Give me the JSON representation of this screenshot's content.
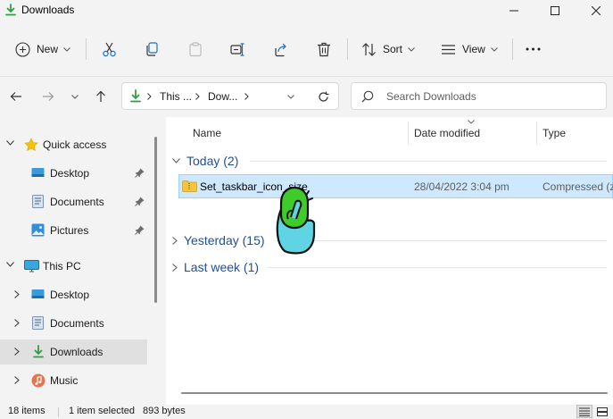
{
  "window": {
    "title": "Downloads"
  },
  "commands": {
    "new_label": "New",
    "sort_label": "Sort",
    "view_label": "View"
  },
  "address": {
    "crumbs": [
      "This ...",
      "Dow..."
    ]
  },
  "search": {
    "placeholder": "Search Downloads"
  },
  "nav": {
    "quick_access": "Quick access",
    "qa_items": [
      "Desktop",
      "Documents",
      "Pictures"
    ],
    "this_pc": "This PC",
    "pc_items": [
      "Desktop",
      "Documents",
      "Downloads",
      "Music"
    ]
  },
  "columns": {
    "name": "Name",
    "date": "Date modified",
    "type": "Type"
  },
  "groups": {
    "today": "Today (2)",
    "yesterday": "Yesterday (15)",
    "last_week": "Last week (1)"
  },
  "file": {
    "name": "Set_taskbar_icon_size",
    "date": "28/04/2022 3:04 pm",
    "type": "Compressed (zi"
  },
  "status": {
    "count": "18 items",
    "selected": "1 item selected",
    "size": "893 bytes"
  },
  "colors": {
    "accent_green": "#2f9e44",
    "folder_yellow": "#f5c542",
    "selection": "#cde8ff",
    "group_text": "#1f4e9a"
  },
  "icons": [
    "downloads-icon",
    "minimize-icon",
    "maximize-icon",
    "close-icon",
    "new-icon",
    "cut-icon",
    "copy-icon",
    "paste-icon",
    "rename-icon",
    "share-icon",
    "delete-icon",
    "sort-icon",
    "view-icon",
    "more-icon",
    "back-icon",
    "forward-icon",
    "recent-icon",
    "up-icon",
    "refresh-icon",
    "search-icon",
    "star-icon",
    "desktop-icon",
    "documents-icon",
    "pictures-icon",
    "pin-icon",
    "pc-icon",
    "music-icon",
    "zip-folder-icon",
    "details-view-icon",
    "tiles-view-icon"
  ]
}
